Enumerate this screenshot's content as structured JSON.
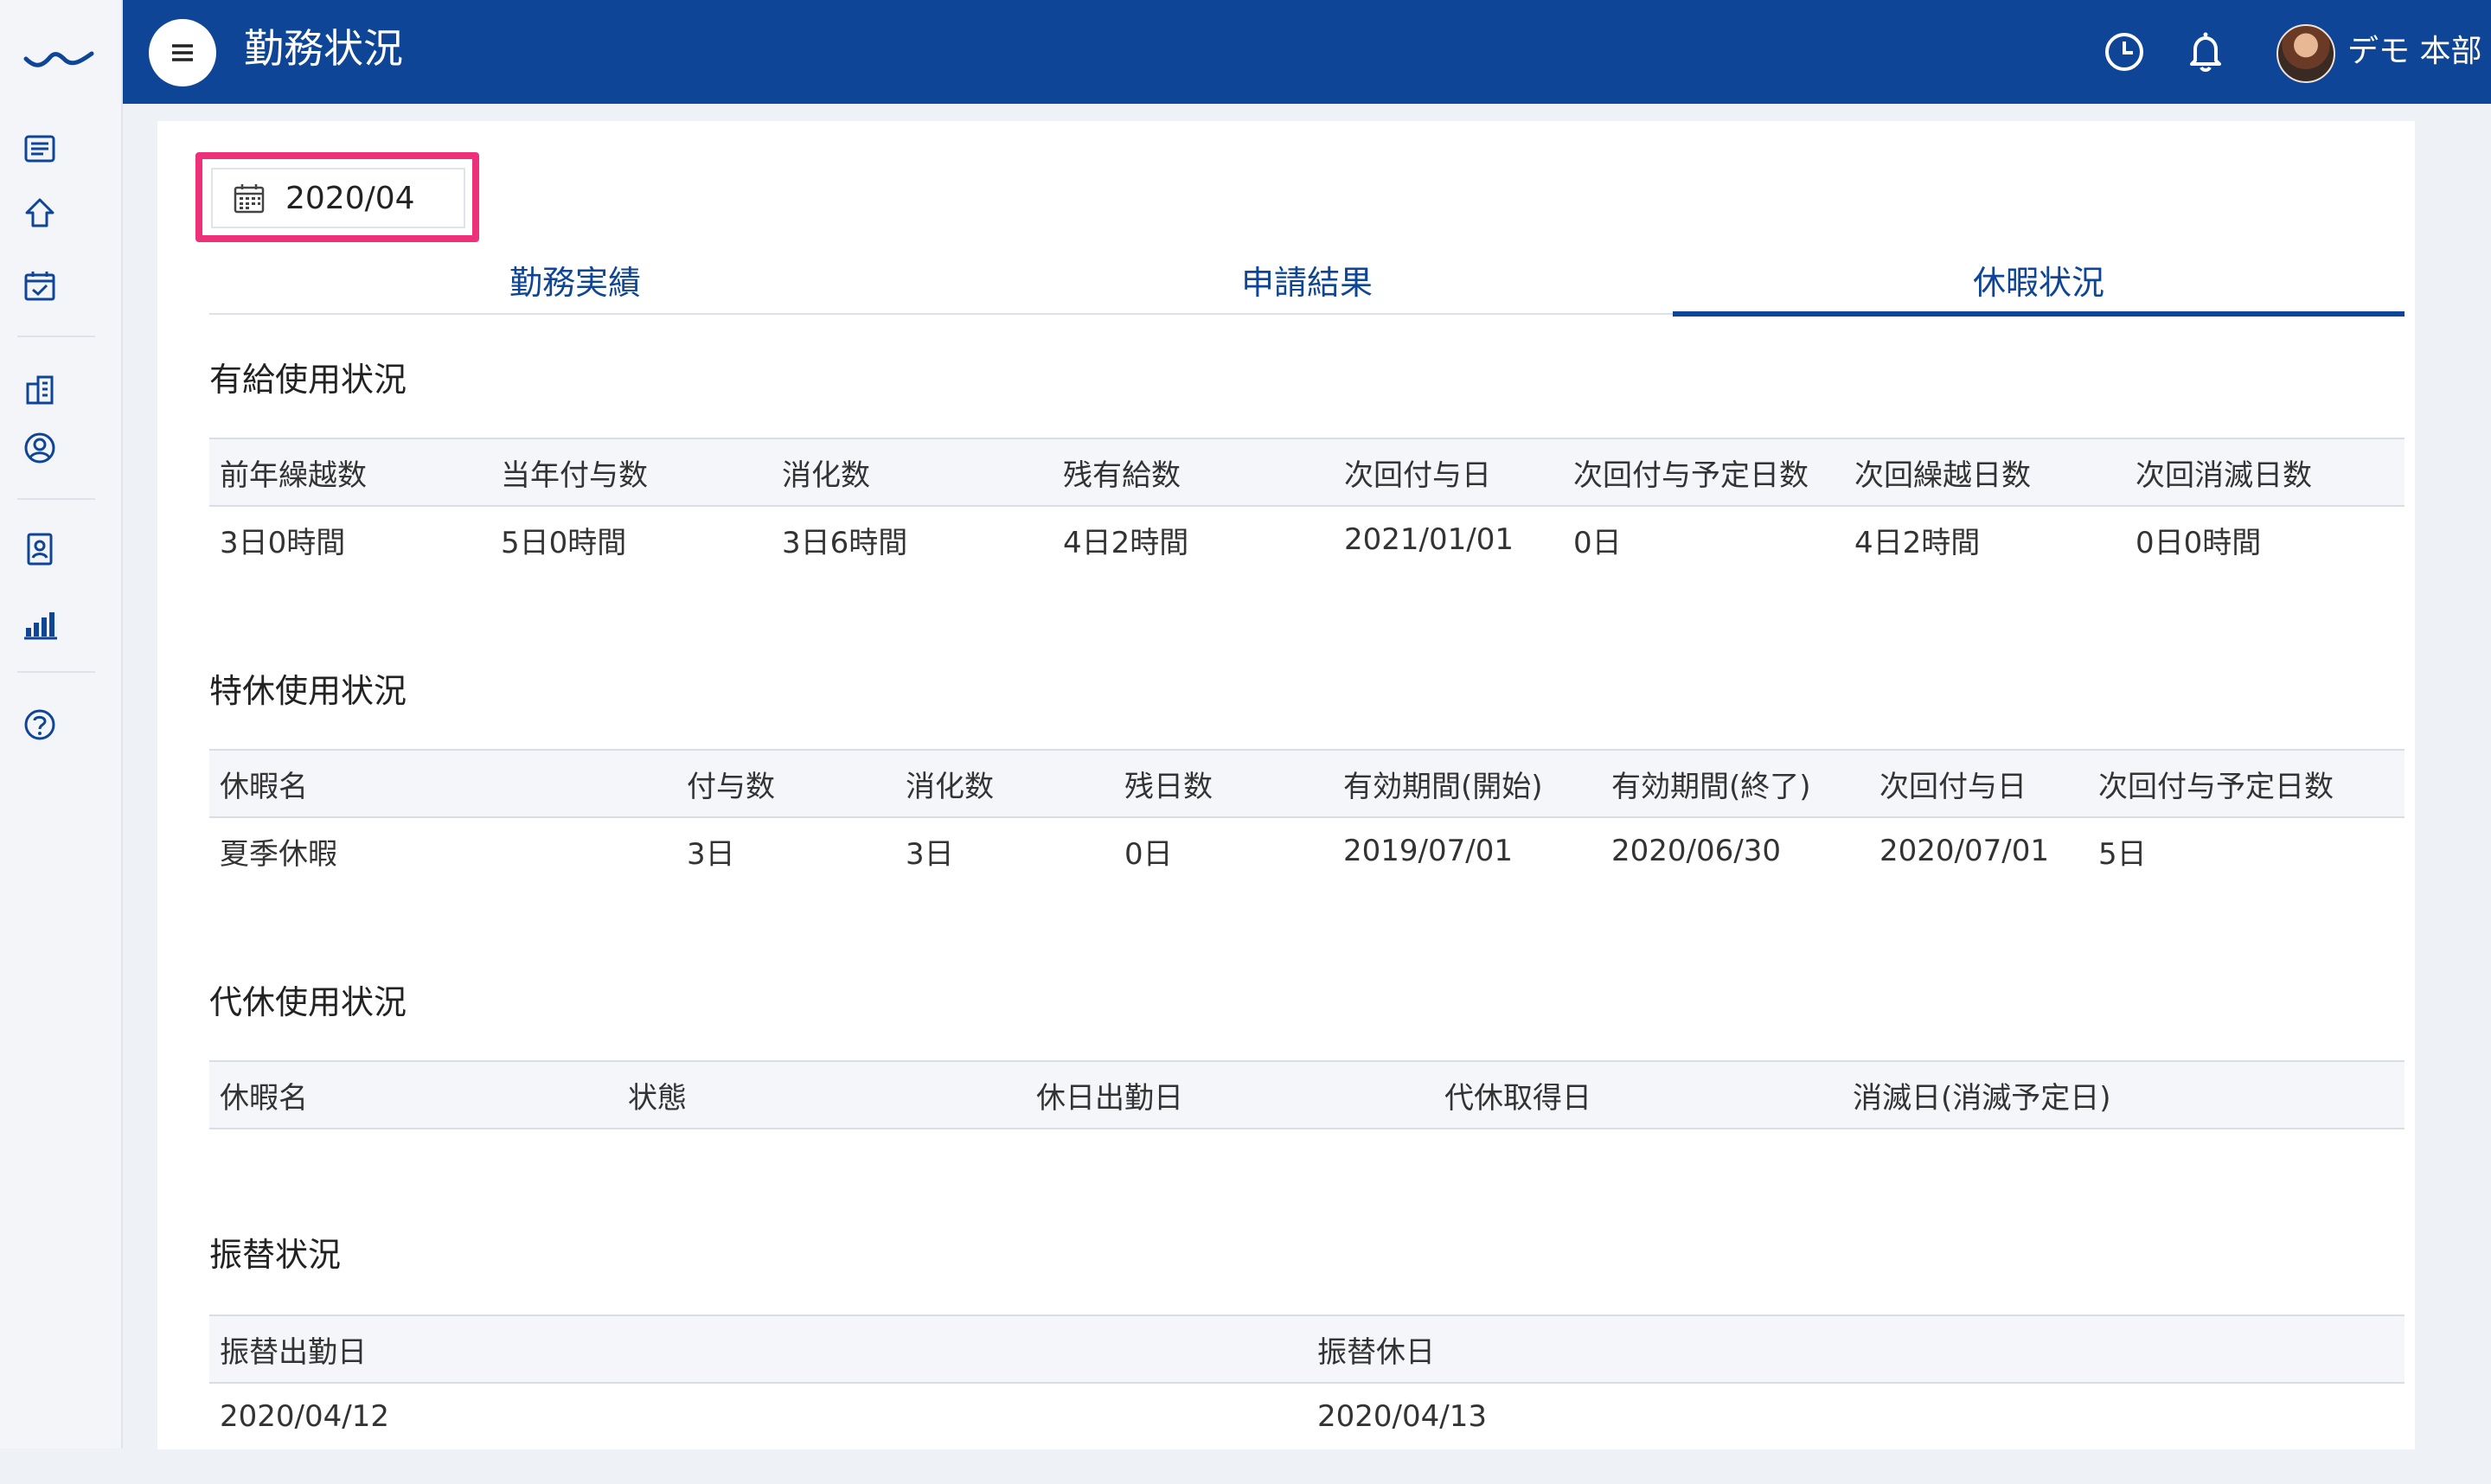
{
  "app": {
    "title": "勤務状況",
    "user_name": "デモ 本部"
  },
  "sidebar": {
    "items": [
      {
        "icon": "list-icon"
      },
      {
        "icon": "home-icon"
      },
      {
        "icon": "calendar-check-icon"
      },
      {
        "icon": "building-icon"
      },
      {
        "icon": "user-circle-icon"
      },
      {
        "icon": "id-badge-icon"
      },
      {
        "icon": "bar-chart-icon"
      },
      {
        "icon": "help-icon"
      }
    ]
  },
  "header_icons": [
    "clock-icon",
    "bell-icon"
  ],
  "month_picker": {
    "value": "2020/04"
  },
  "tabs": [
    {
      "label": "勤務実績",
      "active": false
    },
    {
      "label": "申請結果",
      "active": false
    },
    {
      "label": "休暇状況",
      "active": true
    }
  ],
  "paid_leave": {
    "title": "有給使用状況",
    "headers": [
      "前年繰越数",
      "当年付与数",
      "消化数",
      "残有給数",
      "次回付与日",
      "次回付与予定日数",
      "次回繰越日数",
      "次回消滅日数"
    ],
    "rows": [
      [
        "3日0時間",
        "5日0時間",
        "3日6時間",
        "4日2時間",
        "2021/01/01",
        "0日",
        "4日2時間",
        "0日0時間"
      ]
    ]
  },
  "special_leave": {
    "title": "特休使用状況",
    "headers": [
      "休暇名",
      "付与数",
      "消化数",
      "残日数",
      "有効期間(開始)",
      "有効期間(終了)",
      "次回付与日",
      "次回付与予定日数"
    ],
    "rows": [
      [
        "夏季休暇",
        "3日",
        "3日",
        "0日",
        "2019/07/01",
        "2020/06/30",
        "2020/07/01",
        "5日"
      ]
    ]
  },
  "comp_leave": {
    "title": "代休使用状況",
    "headers": [
      "休暇名",
      "状態",
      "休日出勤日",
      "代休取得日",
      "消滅日(消滅予定日)"
    ],
    "rows": []
  },
  "transfer": {
    "title": "振替状況",
    "headers": [
      "振替出勤日",
      "振替休日"
    ],
    "rows": [
      [
        "2020/04/12",
        "2020/04/13"
      ]
    ]
  },
  "colors": {
    "brand": "#0f4596",
    "highlight": "#ee2f7a",
    "header_bg": "#f5f6f9"
  }
}
